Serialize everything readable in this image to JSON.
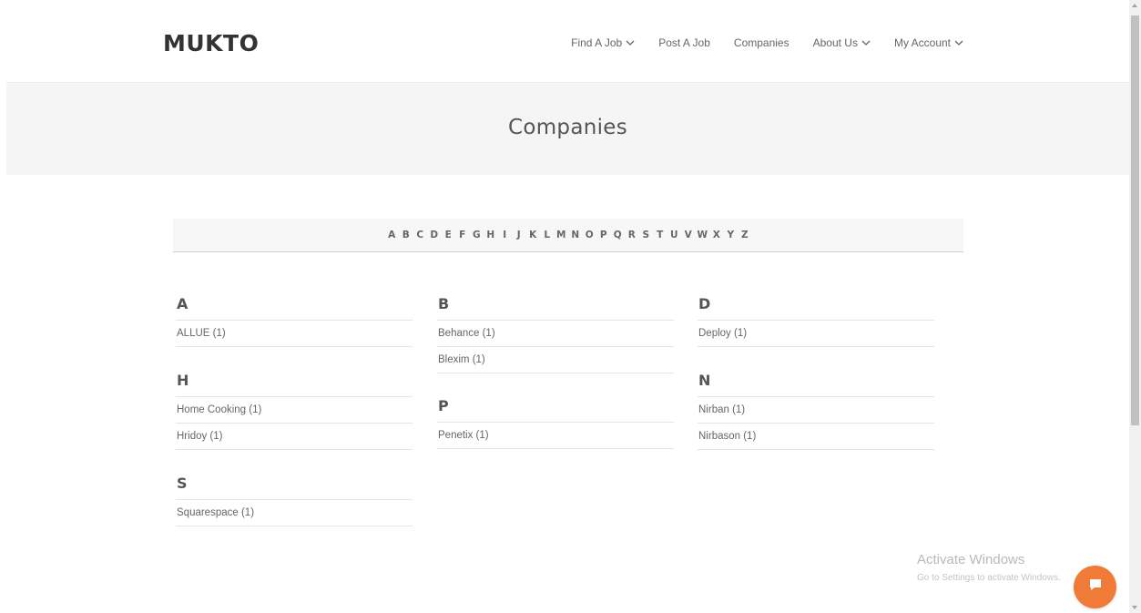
{
  "brand": {
    "logo": "MUKTO"
  },
  "nav": {
    "items": [
      {
        "label": "Find A Job",
        "dropdown": true
      },
      {
        "label": "Post A Job",
        "dropdown": false
      },
      {
        "label": "Companies",
        "dropdown": false
      },
      {
        "label": "About Us",
        "dropdown": true
      },
      {
        "label": "My Account",
        "dropdown": true
      }
    ]
  },
  "page": {
    "title": "Companies"
  },
  "alphabet": [
    "A",
    "B",
    "C",
    "D",
    "E",
    "F",
    "G",
    "H",
    "I",
    "J",
    "K",
    "L",
    "M",
    "N",
    "O",
    "P",
    "Q",
    "R",
    "S",
    "T",
    "U",
    "V",
    "W",
    "X",
    "Y",
    "Z"
  ],
  "groups": [
    {
      "letter": "A",
      "companies": [
        "ALLUE (1)"
      ]
    },
    {
      "letter": "B",
      "companies": [
        "Behance (1)",
        "Blexim (1)"
      ]
    },
    {
      "letter": "D",
      "companies": [
        "Deploy (1)"
      ]
    },
    {
      "letter": "H",
      "companies": [
        "Home Cooking (1)",
        "Hridoy (1)"
      ]
    },
    {
      "letter": "P",
      "companies": [
        "Penetix (1)"
      ]
    },
    {
      "letter": "N",
      "companies": [
        "Nirban (1)",
        "Nirbason (1)"
      ]
    },
    {
      "letter": "S",
      "companies": [
        "Squarespace (1)"
      ]
    }
  ],
  "watermark": {
    "title": "Activate Windows",
    "subtitle": "Go to Settings to activate Windows."
  },
  "colors": {
    "accent": "#f07b39",
    "title_band": "#f5f5f5"
  },
  "icons": {
    "chat": "chat-bubble-icon",
    "dropdown": "chevron-down-icon"
  }
}
